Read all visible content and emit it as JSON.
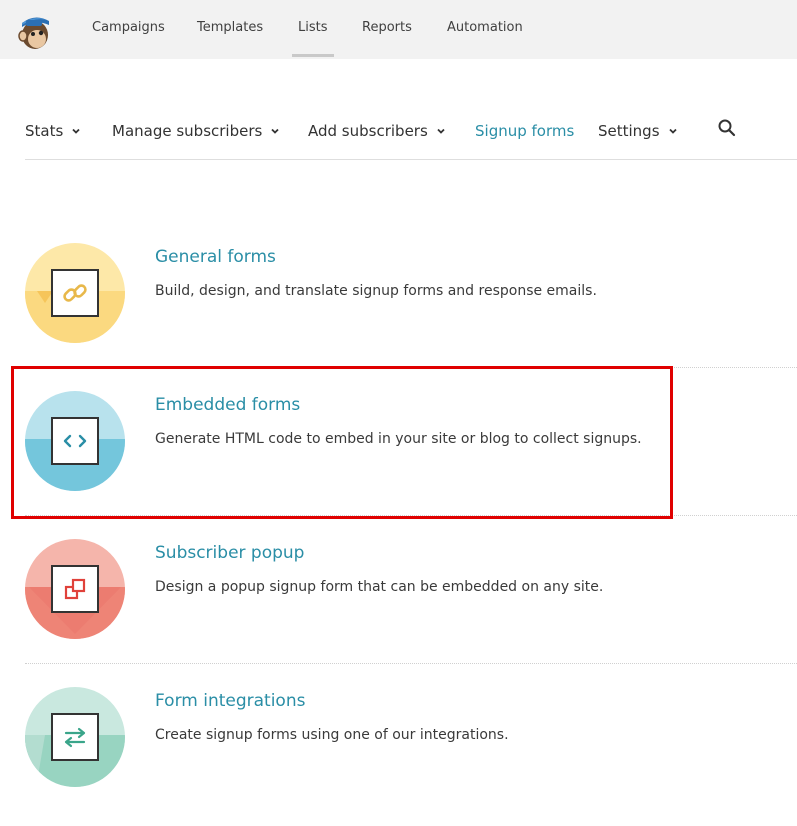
{
  "topnav": {
    "items": [
      {
        "label": "Campaigns"
      },
      {
        "label": "Templates"
      },
      {
        "label": "Lists"
      },
      {
        "label": "Reports"
      },
      {
        "label": "Automation"
      }
    ],
    "active": "Lists"
  },
  "subnav": {
    "items": [
      {
        "label": "Stats",
        "has_dropdown": true
      },
      {
        "label": "Manage subscribers",
        "has_dropdown": true
      },
      {
        "label": "Add subscribers",
        "has_dropdown": true
      },
      {
        "label": "Signup forms",
        "has_dropdown": false
      },
      {
        "label": "Settings",
        "has_dropdown": true
      }
    ],
    "active": "Signup forms",
    "search_icon": "search-icon"
  },
  "options": [
    {
      "title": "General forms",
      "description": "Build, design, and translate signup forms and response emails.",
      "icon": "link-icon",
      "color_light": "#fde8a8",
      "color_dark": "#fbd980",
      "glyph_color": "#e8b84a"
    },
    {
      "title": "Embedded forms",
      "description": "Generate HTML code to embed in your site or blog to collect signups.",
      "icon": "code-icon",
      "color_light": "#b8e2ed",
      "color_dark": "#74c6dc",
      "glyph_color": "#2a8ea6"
    },
    {
      "title": "Subscriber popup",
      "description": "Design a popup signup form that can be embedded on any site.",
      "icon": "popup-icon",
      "color_light": "#f5b5ab",
      "color_dark": "#ee8476",
      "glyph_color": "#e0413a"
    },
    {
      "title": "Form integrations",
      "description": "Create signup forms using one of our integrations.",
      "icon": "swap-arrows-icon",
      "color_light": "#c9e8df",
      "color_dark": "#98d4c1",
      "glyph_color": "#3aa58a"
    }
  ],
  "highlighted_option": "Embedded forms",
  "colors": {
    "accent": "#2a8ea6",
    "highlight_border": "#e00000",
    "topbar_bg": "#f2f2f2"
  }
}
